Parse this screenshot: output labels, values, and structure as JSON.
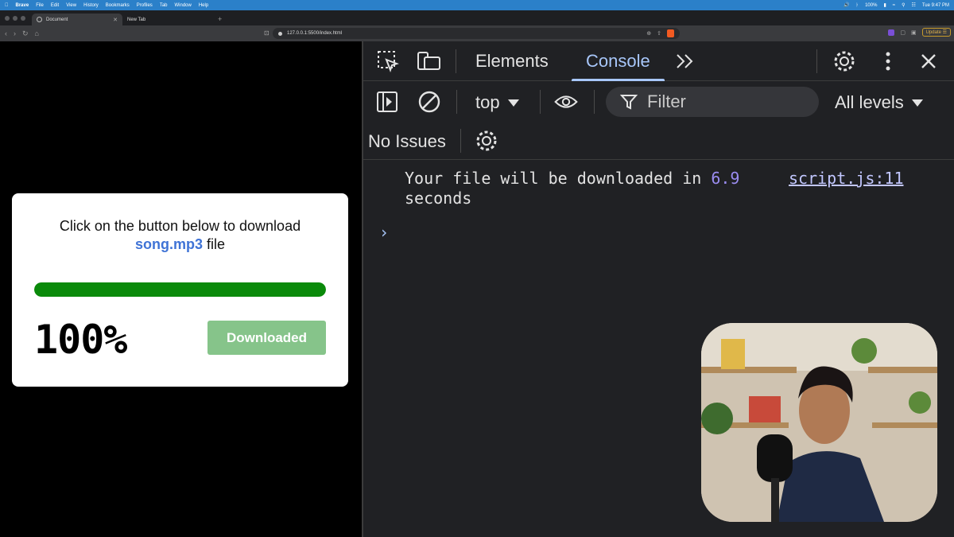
{
  "menubar": {
    "app": "Brave",
    "items": [
      "File",
      "Edit",
      "View",
      "History",
      "Bookmarks",
      "Profiles",
      "Tab",
      "Window",
      "Help"
    ],
    "battery": "100%",
    "clock": "Tue 9:47 PM"
  },
  "tabs": [
    {
      "label": "Document",
      "active": true
    },
    {
      "label": "New Tab",
      "active": false
    }
  ],
  "address": {
    "url": "127.0.0.1:5500/index.html",
    "update_label": "Update"
  },
  "page": {
    "title_line1": "Click on the button below to download",
    "title_file": "song.mp3",
    "title_suffix": " file",
    "progress_percent": 100,
    "progress_color": "#0a8a0a",
    "percent_label": "100%",
    "button_label": "Downloaded",
    "button_color": "#86c48a"
  },
  "devtools": {
    "tab_elements": "Elements",
    "tab_console": "Console",
    "context": "top",
    "filter_placeholder": "Filter",
    "levels": "All levels",
    "issues": "No Issues",
    "log_prefix": "Your file will be downloaded in ",
    "log_number": "6.9",
    "log_suffix": "seconds",
    "source": "script.js:11",
    "accent": "#a8c7fa"
  }
}
